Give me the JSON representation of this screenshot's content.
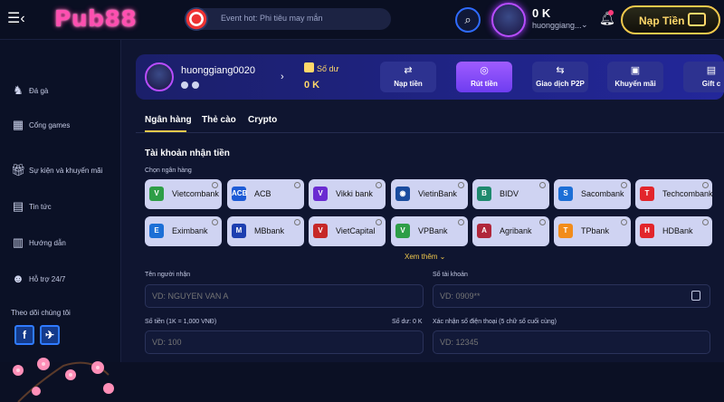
{
  "header": {
    "logo_text": "Pub88",
    "event_text": "Event hot: Phi tiêu may mắn",
    "balance": "0 K",
    "username": "huonggiang...",
    "deposit_label": "Nạp Tiền"
  },
  "sidebar": {
    "items": [
      {
        "label": "Đá gà",
        "icon": "rooster-icon"
      },
      {
        "label": "Cổng games",
        "icon": "grid-icon"
      },
      {
        "label": "Sự kiện và khuyến mãi",
        "icon": "gift-icon"
      },
      {
        "label": "Tin tức",
        "icon": "news-icon"
      },
      {
        "label": "Hướng dẫn",
        "icon": "book-icon"
      },
      {
        "label": "Hỗ trợ 24/7",
        "icon": "support-icon"
      }
    ],
    "follow_label": "Theo dõi chúng tôi",
    "social": [
      "f",
      "✈"
    ]
  },
  "profile": {
    "username": "huonggiang0020",
    "balance_label": "Số dư",
    "balance": "0 K",
    "actions": [
      {
        "label": "Nạp tiền",
        "icon": "⇄",
        "active": false
      },
      {
        "label": "Rút tiền",
        "icon": "◎",
        "active": true
      },
      {
        "label": "Giao dịch P2P",
        "icon": "⇆",
        "active": false
      },
      {
        "label": "Khuyến mãi",
        "icon": "▣",
        "active": false
      },
      {
        "label": "Gift c",
        "icon": "▤",
        "active": false
      }
    ]
  },
  "tabs": [
    "Ngân hàng",
    "Thẻ cào",
    "Crypto"
  ],
  "form": {
    "title": "Tài khoản nhận tiền",
    "bank_select_label": "Chọn ngân hàng",
    "banks": [
      {
        "name": "Vietcombank",
        "color": "#2e9e47",
        "logo": "V"
      },
      {
        "name": "ACB",
        "color": "#1d5bd6",
        "logo": "ACB"
      },
      {
        "name": "Vikki bank",
        "color": "#6a2bd1",
        "logo": "V"
      },
      {
        "name": "VietinBank",
        "color": "#1a4c9e",
        "logo": "◉"
      },
      {
        "name": "BIDV",
        "color": "#1f8a6e",
        "logo": "B"
      },
      {
        "name": "Sacombank",
        "color": "#1d6fd6",
        "logo": "S"
      },
      {
        "name": "Techcombank",
        "color": "#e2252b",
        "logo": "T"
      },
      {
        "name": "Eximbank",
        "color": "#1d6fd6",
        "logo": "E"
      },
      {
        "name": "MBbank",
        "color": "#1d3fb0",
        "logo": "M"
      },
      {
        "name": "VietCapital",
        "color": "#c62828",
        "logo": "V"
      },
      {
        "name": "VPBank",
        "color": "#2e9e47",
        "logo": "V"
      },
      {
        "name": "Agribank",
        "color": "#b0263a",
        "logo": "A"
      },
      {
        "name": "TPbank",
        "color": "#f28c1a",
        "logo": "T"
      },
      {
        "name": "HDBank",
        "color": "#e2252b",
        "logo": "H"
      }
    ],
    "see_more": "Xem thêm ⌄",
    "recipient_label": "Tên người nhận",
    "recipient_placeholder": "VD: NGUYEN VAN A",
    "account_label": "Số tài khoản",
    "account_placeholder": "VD: 0909**",
    "amount_label": "Số tiền (1K = 1,000 VNĐ)",
    "amount_balance": "Số dư: 0 K",
    "amount_placeholder": "VD: 100",
    "phone_label": "Xác nhận số điện thoại (5 chữ số cuối cùng)",
    "phone_placeholder": "VD: 12345"
  }
}
